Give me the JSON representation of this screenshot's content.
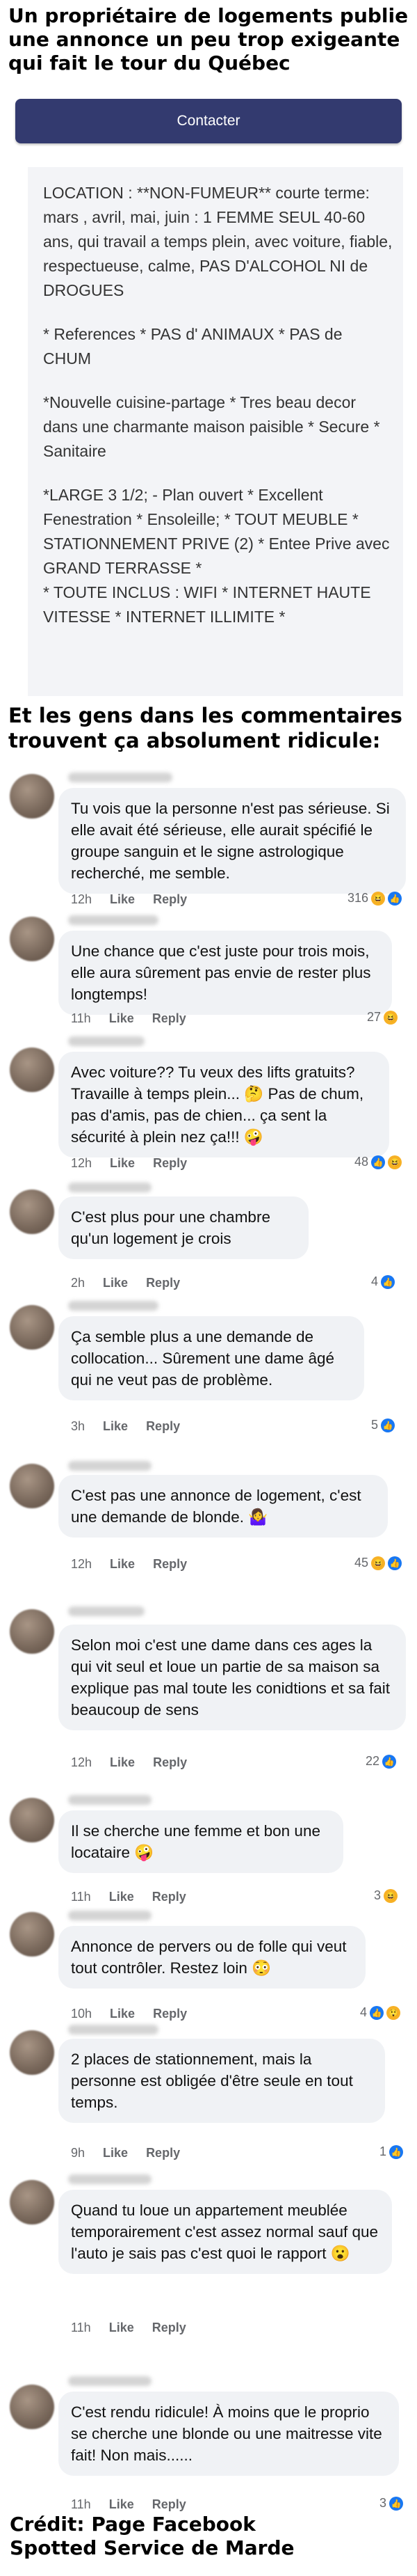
{
  "headline_top": "Un propriétaire de logements publie une annonce un peu trop exigeante qui fait le tour du Québec",
  "contact_button": "Contacter",
  "ad_paragraphs": [
    "LOCATION : **NON-FUMEUR** courte terme: mars , avril, mai, juin : 1 FEMME SEUL 40-60 ans, qui travail a temps plein, avec voiture, fiable, respectueuse, calme, PAS D'ALCOHOL NI de DROGUES",
    "* References * PAS d' ANIMAUX * PAS de CHUM",
    "*Nouvelle cuisine-partage * Tres beau decor dans une charmante maison paisible * Secure * Sanitaire",
    "*LARGE 3 1/2; - Plan ouvert * Excellent Fenestration * Ensoleille; * TOUT MEUBLE * STATIONNEMENT PRIVE (2) * Entee Prive avec GRAND TERRASSE *",
    "* TOUTE INCLUS : WIFI * INTERNET HAUTE VITESSE * INTERNET ILLIMITE *"
  ],
  "headline_mid": "Et les gens dans les commentaires trouvent ça absolument ridicule:",
  "comments": [
    {
      "text": "Tu vois que la personne n'est pas sérieuse. Si elle avait été sérieuse, elle aurait spécifié le groupe sanguin et le signe astrologique recherché, me semble.",
      "time": "12h",
      "like": "Like",
      "reply": "Reply",
      "count": "316",
      "reactions": [
        "haha-icon",
        "like-icon"
      ]
    },
    {
      "text": "Une chance que c'est juste pour trois mois, elle aura sûrement pas envie de rester plus longtemps!",
      "time": "11h",
      "like": "Like",
      "reply": "Reply",
      "count": "27",
      "reactions": [
        "haha-icon"
      ]
    },
    {
      "text": "Avec voiture?? Tu veux des lifts gratuits? Travaille à temps plein... 🤔 Pas de chum, pas d'amis, pas de chien... ça sent la sécurité à plein nez ça!!! 🤪",
      "time": "12h",
      "like": "Like",
      "reply": "Reply",
      "count": "48",
      "reactions": [
        "like-icon",
        "haha-icon"
      ]
    },
    {
      "text": "C'est plus pour une chambre qu'un logement je crois",
      "time": "2h",
      "like": "Like",
      "reply": "Reply",
      "count": "4",
      "reactions": [
        "like-icon"
      ]
    },
    {
      "text": "Ça semble plus a une demande de collocation... Sûrement une dame âgé qui ne veut pas de problème.",
      "time": "3h",
      "like": "Like",
      "reply": "Reply",
      "count": "5",
      "reactions": [
        "like-icon"
      ]
    },
    {
      "text": "C'est pas une annonce de logement, c'est une demande de blonde. 🤷‍♀️",
      "time": "12h",
      "like": "Like",
      "reply": "Reply",
      "count": "45",
      "reactions": [
        "haha-icon",
        "like-icon"
      ]
    },
    {
      "text": "Selon moi c'est une dame dans ces ages la qui vit seul et loue un partie de sa maison sa explique pas mal toute les conidtions et sa fait beaucoup de sens",
      "time": "12h",
      "like": "Like",
      "reply": "Reply",
      "count": "22",
      "reactions": [
        "like-icon"
      ]
    },
    {
      "text": "Il se cherche une femme et bon une locataire 🤪",
      "time": "11h",
      "like": "Like",
      "reply": "Reply",
      "count": "3",
      "reactions": [
        "haha-icon"
      ]
    },
    {
      "text": "Annonce de pervers ou de folle qui veut tout contrôler. Restez loin 😳",
      "time": "10h",
      "like": "Like",
      "reply": "Reply",
      "count": "4",
      "reactions": [
        "like-icon",
        "care-icon"
      ]
    },
    {
      "text": "2 places de stationnement, mais la personne est obligée d'être seule en tout temps.",
      "time": "9h",
      "like": "Like",
      "reply": "Reply",
      "count": "1",
      "reactions": [
        "like-icon"
      ]
    },
    {
      "text": "Quand tu loue un appartement meublée temporairement c'est assez normal sauf que l'auto je sais pas c'est quoi le rapport 😮",
      "time": "11h",
      "like": "Like",
      "reply": "Reply",
      "count": "",
      "reactions": []
    },
    {
      "text": "C'est rendu ridicule! À moins que le proprio se cherche une blonde ou une maitresse vite fait! Non mais......",
      "time": "11h",
      "like": "Like",
      "reply": "Reply",
      "count": "3",
      "reactions": [
        "like-icon"
      ]
    }
  ],
  "credit_line1": "Crédit: Page Facebook",
  "credit_line2": "Spotted Service de Marde"
}
